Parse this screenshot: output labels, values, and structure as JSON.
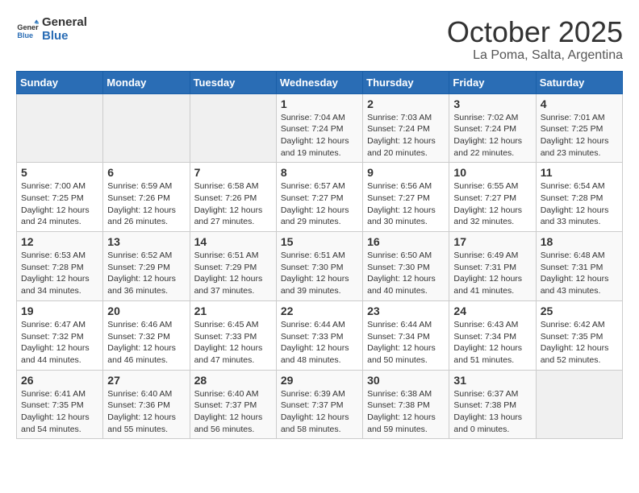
{
  "logo": {
    "line1": "General",
    "line2": "Blue"
  },
  "title": "October 2025",
  "location": "La Poma, Salta, Argentina",
  "weekdays": [
    "Sunday",
    "Monday",
    "Tuesday",
    "Wednesday",
    "Thursday",
    "Friday",
    "Saturday"
  ],
  "weeks": [
    [
      {
        "day": null,
        "info": null
      },
      {
        "day": null,
        "info": null
      },
      {
        "day": null,
        "info": null
      },
      {
        "day": "1",
        "info": "Sunrise: 7:04 AM\nSunset: 7:24 PM\nDaylight: 12 hours\nand 19 minutes."
      },
      {
        "day": "2",
        "info": "Sunrise: 7:03 AM\nSunset: 7:24 PM\nDaylight: 12 hours\nand 20 minutes."
      },
      {
        "day": "3",
        "info": "Sunrise: 7:02 AM\nSunset: 7:24 PM\nDaylight: 12 hours\nand 22 minutes."
      },
      {
        "day": "4",
        "info": "Sunrise: 7:01 AM\nSunset: 7:25 PM\nDaylight: 12 hours\nand 23 minutes."
      }
    ],
    [
      {
        "day": "5",
        "info": "Sunrise: 7:00 AM\nSunset: 7:25 PM\nDaylight: 12 hours\nand 24 minutes."
      },
      {
        "day": "6",
        "info": "Sunrise: 6:59 AM\nSunset: 7:26 PM\nDaylight: 12 hours\nand 26 minutes."
      },
      {
        "day": "7",
        "info": "Sunrise: 6:58 AM\nSunset: 7:26 PM\nDaylight: 12 hours\nand 27 minutes."
      },
      {
        "day": "8",
        "info": "Sunrise: 6:57 AM\nSunset: 7:27 PM\nDaylight: 12 hours\nand 29 minutes."
      },
      {
        "day": "9",
        "info": "Sunrise: 6:56 AM\nSunset: 7:27 PM\nDaylight: 12 hours\nand 30 minutes."
      },
      {
        "day": "10",
        "info": "Sunrise: 6:55 AM\nSunset: 7:27 PM\nDaylight: 12 hours\nand 32 minutes."
      },
      {
        "day": "11",
        "info": "Sunrise: 6:54 AM\nSunset: 7:28 PM\nDaylight: 12 hours\nand 33 minutes."
      }
    ],
    [
      {
        "day": "12",
        "info": "Sunrise: 6:53 AM\nSunset: 7:28 PM\nDaylight: 12 hours\nand 34 minutes."
      },
      {
        "day": "13",
        "info": "Sunrise: 6:52 AM\nSunset: 7:29 PM\nDaylight: 12 hours\nand 36 minutes."
      },
      {
        "day": "14",
        "info": "Sunrise: 6:51 AM\nSunset: 7:29 PM\nDaylight: 12 hours\nand 37 minutes."
      },
      {
        "day": "15",
        "info": "Sunrise: 6:51 AM\nSunset: 7:30 PM\nDaylight: 12 hours\nand 39 minutes."
      },
      {
        "day": "16",
        "info": "Sunrise: 6:50 AM\nSunset: 7:30 PM\nDaylight: 12 hours\nand 40 minutes."
      },
      {
        "day": "17",
        "info": "Sunrise: 6:49 AM\nSunset: 7:31 PM\nDaylight: 12 hours\nand 41 minutes."
      },
      {
        "day": "18",
        "info": "Sunrise: 6:48 AM\nSunset: 7:31 PM\nDaylight: 12 hours\nand 43 minutes."
      }
    ],
    [
      {
        "day": "19",
        "info": "Sunrise: 6:47 AM\nSunset: 7:32 PM\nDaylight: 12 hours\nand 44 minutes."
      },
      {
        "day": "20",
        "info": "Sunrise: 6:46 AM\nSunset: 7:32 PM\nDaylight: 12 hours\nand 46 minutes."
      },
      {
        "day": "21",
        "info": "Sunrise: 6:45 AM\nSunset: 7:33 PM\nDaylight: 12 hours\nand 47 minutes."
      },
      {
        "day": "22",
        "info": "Sunrise: 6:44 AM\nSunset: 7:33 PM\nDaylight: 12 hours\nand 48 minutes."
      },
      {
        "day": "23",
        "info": "Sunrise: 6:44 AM\nSunset: 7:34 PM\nDaylight: 12 hours\nand 50 minutes."
      },
      {
        "day": "24",
        "info": "Sunrise: 6:43 AM\nSunset: 7:34 PM\nDaylight: 12 hours\nand 51 minutes."
      },
      {
        "day": "25",
        "info": "Sunrise: 6:42 AM\nSunset: 7:35 PM\nDaylight: 12 hours\nand 52 minutes."
      }
    ],
    [
      {
        "day": "26",
        "info": "Sunrise: 6:41 AM\nSunset: 7:35 PM\nDaylight: 12 hours\nand 54 minutes."
      },
      {
        "day": "27",
        "info": "Sunrise: 6:40 AM\nSunset: 7:36 PM\nDaylight: 12 hours\nand 55 minutes."
      },
      {
        "day": "28",
        "info": "Sunrise: 6:40 AM\nSunset: 7:37 PM\nDaylight: 12 hours\nand 56 minutes."
      },
      {
        "day": "29",
        "info": "Sunrise: 6:39 AM\nSunset: 7:37 PM\nDaylight: 12 hours\nand 58 minutes."
      },
      {
        "day": "30",
        "info": "Sunrise: 6:38 AM\nSunset: 7:38 PM\nDaylight: 12 hours\nand 59 minutes."
      },
      {
        "day": "31",
        "info": "Sunrise: 6:37 AM\nSunset: 7:38 PM\nDaylight: 13 hours\nand 0 minutes."
      },
      {
        "day": null,
        "info": null
      }
    ]
  ]
}
